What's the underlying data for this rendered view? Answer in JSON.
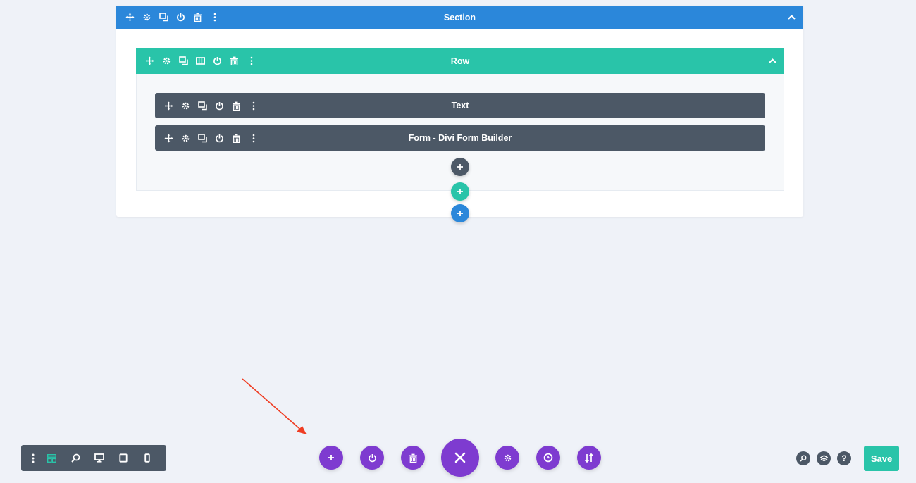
{
  "colors": {
    "background": "#eff2f8",
    "section_blue": "#2b87da",
    "row_teal": "#29c4a9",
    "module_slate": "#4c5866",
    "page_purple": "#7e3bd0",
    "save_green": "#29c4a9",
    "annotation_arrow": "#ef3d23"
  },
  "section": {
    "title": "Section",
    "tool_icons": [
      "move-icon",
      "gear-icon",
      "duplicate-icon",
      "power-icon",
      "trash-icon",
      "more-vertical-icon"
    ],
    "collapse_icon": "chevron-up-icon"
  },
  "row": {
    "title": "Row",
    "tool_icons": [
      "move-icon",
      "gear-icon",
      "duplicate-icon",
      "columns-icon",
      "power-icon",
      "trash-icon",
      "more-vertical-icon"
    ],
    "collapse_icon": "chevron-up-icon"
  },
  "modules": [
    {
      "title": "Text"
    },
    {
      "title": "Form - Divi Form Builder"
    }
  ],
  "add_buttons": {
    "module": "+",
    "row": "+",
    "section": "+"
  },
  "view_bar": {
    "icons": [
      "more-vertical-icon",
      "wireframe-icon",
      "zoom-icon",
      "desktop-icon",
      "tablet-icon",
      "phone-icon"
    ]
  },
  "page_bar": {
    "icons": [
      "plus-icon",
      "power-icon",
      "trash-icon",
      "close-icon",
      "gear-icon",
      "history-icon",
      "portability-icon"
    ]
  },
  "utility_icons": [
    "search-icon",
    "layers-icon",
    "help-icon"
  ],
  "help_label": "?",
  "save_label": "Save"
}
